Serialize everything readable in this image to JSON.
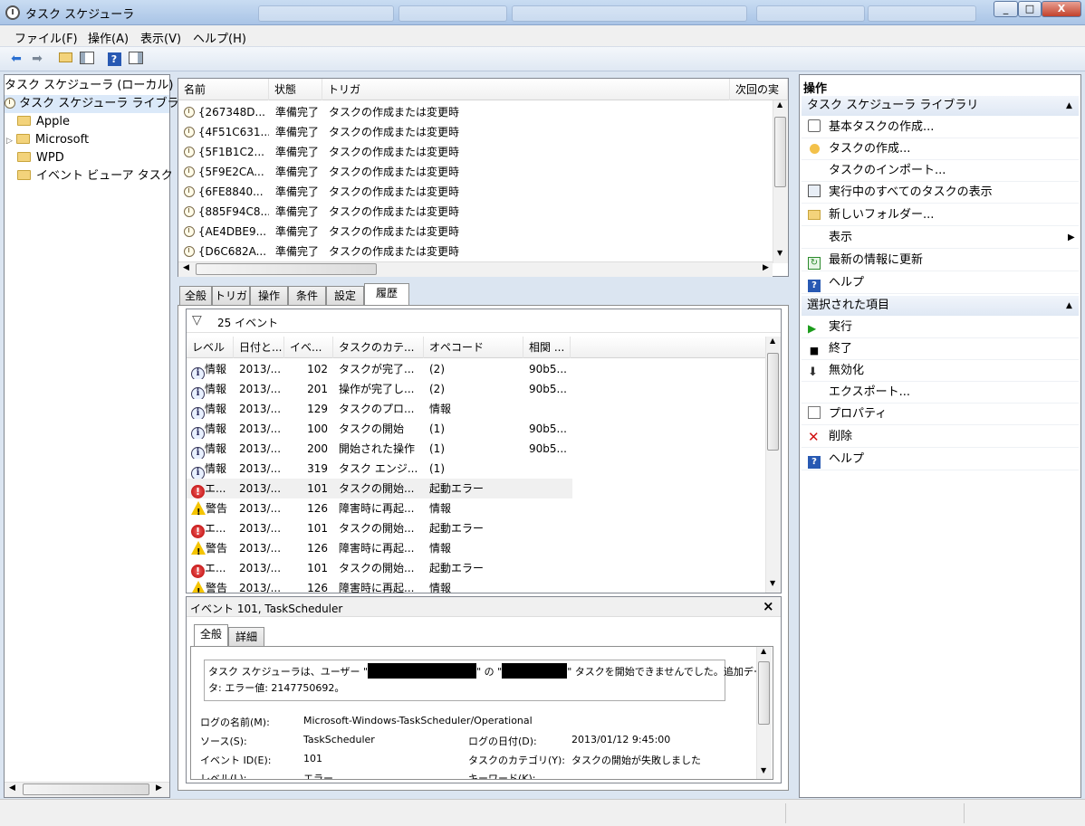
{
  "window": {
    "title": "タスク スケジューラ",
    "btn_min": "_",
    "btn_max": "□",
    "btn_close": "X"
  },
  "menu": [
    "ファイル(F)",
    "操作(A)",
    "表示(V)",
    "ヘルプ(H)"
  ],
  "tree": {
    "root": "タスク スケジューラ (ローカル)",
    "library": "タスク スケジューラ ライブラリ",
    "folders": [
      "Apple",
      "Microsoft",
      "WPD",
      "イベント ビューア タスク"
    ]
  },
  "task_list": {
    "columns": [
      "名前",
      "状態",
      "トリガ",
      "次回の実"
    ],
    "rows": [
      {
        "name": "{267348D...",
        "status": "準備完了",
        "trigger": "タスクの作成または変更時"
      },
      {
        "name": "{4F51C631...",
        "status": "準備完了",
        "trigger": "タスクの作成または変更時"
      },
      {
        "name": "{5F1B1C2...",
        "status": "準備完了",
        "trigger": "タスクの作成または変更時"
      },
      {
        "name": "{5F9E2CA...",
        "status": "準備完了",
        "trigger": "タスクの作成または変更時"
      },
      {
        "name": "{6FE8840...",
        "status": "準備完了",
        "trigger": "タスクの作成または変更時"
      },
      {
        "name": "{885F94C8...",
        "status": "準備完了",
        "trigger": "タスクの作成または変更時"
      },
      {
        "name": "{AE4DBE9...",
        "status": "準備完了",
        "trigger": "タスクの作成または変更時"
      },
      {
        "name": "{D6C682A...",
        "status": "準備完了",
        "trigger": "タスクの作成または変更時"
      }
    ]
  },
  "tabs": [
    "全般",
    "トリガ",
    "操作",
    "条件",
    "設定",
    "履歴"
  ],
  "history": {
    "filter_text": "25 イベント",
    "columns": [
      "レベル",
      "日付と...",
      "イベ...",
      "タスクのカテ...",
      "オペコード",
      "相関 ..."
    ],
    "rows": [
      {
        "icon": "info",
        "level": "情報",
        "date": "2013/...",
        "id": "102",
        "category": "タスクが完了...",
        "opcode": "(2)",
        "corr": "90b5..."
      },
      {
        "icon": "info",
        "level": "情報",
        "date": "2013/...",
        "id": "201",
        "category": "操作が完了し...",
        "opcode": "(2)",
        "corr": "90b5..."
      },
      {
        "icon": "info",
        "level": "情報",
        "date": "2013/...",
        "id": "129",
        "category": "タスクのプロ...",
        "opcode": "情報",
        "corr": ""
      },
      {
        "icon": "info",
        "level": "情報",
        "date": "2013/...",
        "id": "100",
        "category": "タスクの開始",
        "opcode": "(1)",
        "corr": "90b5..."
      },
      {
        "icon": "info",
        "level": "情報",
        "date": "2013/...",
        "id": "200",
        "category": "開始された操作",
        "opcode": "(1)",
        "corr": "90b5..."
      },
      {
        "icon": "info",
        "level": "情報",
        "date": "2013/...",
        "id": "319",
        "category": "タスク エンジ...",
        "opcode": "(1)",
        "corr": ""
      },
      {
        "icon": "error",
        "level": "エ...",
        "date": "2013/...",
        "id": "101",
        "category": "タスクの開始...",
        "opcode": "起動エラー",
        "corr": ""
      },
      {
        "icon": "warn",
        "level": "警告",
        "date": "2013/...",
        "id": "126",
        "category": "障害時に再起...",
        "opcode": "情報",
        "corr": ""
      },
      {
        "icon": "error",
        "level": "エ...",
        "date": "2013/...",
        "id": "101",
        "category": "タスクの開始...",
        "opcode": "起動エラー",
        "corr": ""
      },
      {
        "icon": "warn",
        "level": "警告",
        "date": "2013/...",
        "id": "126",
        "category": "障害時に再起...",
        "opcode": "情報",
        "corr": ""
      },
      {
        "icon": "error",
        "level": "エ...",
        "date": "2013/...",
        "id": "101",
        "category": "タスクの開始...",
        "opcode": "起動エラー",
        "corr": ""
      },
      {
        "icon": "warn",
        "level": "警告",
        "date": "2013/...",
        "id": "126",
        "category": "障害時に再起...",
        "opcode": "情報",
        "corr": ""
      }
    ]
  },
  "event_detail": {
    "title": "イベント 101, TaskScheduler",
    "close": "×",
    "tabs": [
      "全般",
      "詳細"
    ],
    "msg_part1": "タスク スケジューラは、ユーザー \"",
    "msg_part2": "\" の \"",
    "msg_part3": "\" タスクを開始できませんでした。追加デー",
    "msg_line2": "タ: エラー値: 2147750692。",
    "fields": {
      "log_name_label": "ログの名前(M):",
      "log_name": "Microsoft-Windows-TaskScheduler/Operational",
      "source_label": "ソース(S):",
      "source": "TaskScheduler",
      "logdate_label": "ログの日付(D):",
      "logdate": "2013/01/12 9:45:00",
      "eventid_label": "イベント ID(E):",
      "eventid": "101",
      "category_label": "タスクのカテゴリ(Y):",
      "category": "タスクの開始が失敗しました",
      "level_label": "レベル(L):",
      "level": "エラー",
      "keyword_label": "キーワード(K):"
    }
  },
  "actions": {
    "title": "操作",
    "section1": "タスク スケジューラ ライブラリ",
    "items1": [
      "基本タスクの作成...",
      "タスクの作成...",
      "タスクのインポート...",
      "実行中のすべてのタスクの表示",
      "新しいフォルダー...",
      "表示",
      "最新の情報に更新",
      "ヘルプ"
    ],
    "section2": "選択された項目",
    "items2": [
      "実行",
      "終了",
      "無効化",
      "エクスポート...",
      "プロパティ",
      "削除",
      "ヘルプ"
    ]
  }
}
